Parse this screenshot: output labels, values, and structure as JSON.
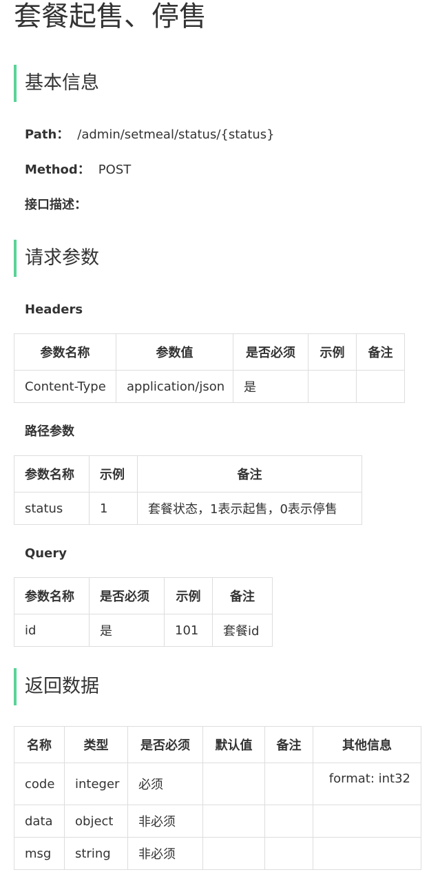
{
  "title": "套餐起售、停售",
  "basic_info": {
    "heading": "基本信息",
    "path_label": "Path：",
    "path_value": "/admin/setmeal/status/{status}",
    "method_label": "Method：",
    "method_value": "POST",
    "desc_label": "接口描述："
  },
  "request": {
    "heading": "请求参数",
    "headers": {
      "title": "Headers",
      "columns": [
        "参数名称",
        "参数值",
        "是否必须",
        "示例",
        "备注"
      ],
      "rows": [
        [
          "Content-Type",
          "application/json",
          "是",
          "",
          ""
        ]
      ]
    },
    "path_params": {
      "title": "路径参数",
      "columns": [
        "参数名称",
        "示例",
        "备注"
      ],
      "rows": [
        [
          "status",
          "1",
          "套餐状态，1表示起售，0表示停售"
        ]
      ]
    },
    "query": {
      "title": "Query",
      "columns": [
        "参数名称",
        "是否必须",
        "示例",
        "备注"
      ],
      "rows": [
        [
          "id",
          "是",
          "101",
          "套餐id"
        ]
      ]
    }
  },
  "response": {
    "heading": "返回数据",
    "columns": [
      "名称",
      "类型",
      "是否必须",
      "默认值",
      "备注",
      "其他信息"
    ],
    "rows": [
      [
        "code",
        "integer",
        "必须",
        "",
        "",
        "format: int32"
      ],
      [
        "data",
        "object",
        "非必须",
        "",
        "",
        ""
      ],
      [
        "msg",
        "string",
        "非必须",
        "",
        "",
        ""
      ]
    ]
  },
  "colors": {
    "accent": "#59d397",
    "border": "#dddddd",
    "text": "#333333"
  }
}
